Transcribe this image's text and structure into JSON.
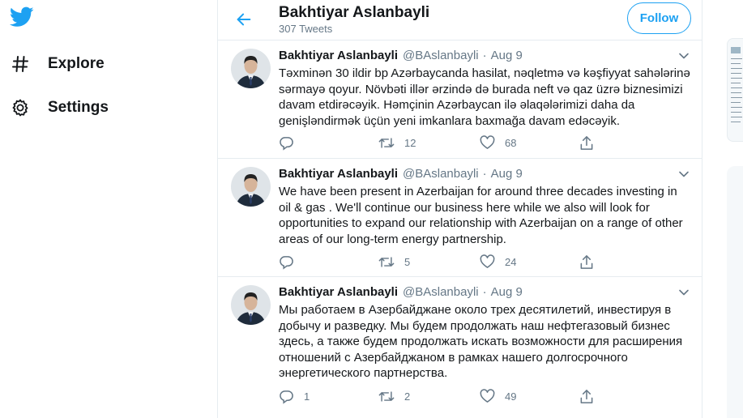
{
  "colors": {
    "accent": "#1da1f2",
    "text": "#14171a",
    "muted": "#657786",
    "border": "#e6ecf0"
  },
  "nav": {
    "logo_icon": "twitter-bird-icon",
    "items": [
      {
        "label": "Explore",
        "icon": "hashtag-icon"
      },
      {
        "label": "Settings",
        "icon": "gear-icon"
      }
    ]
  },
  "header": {
    "name": "Bakhtiyar Aslanbayli",
    "tweet_count": "307 Tweets",
    "follow_label": "Follow",
    "back_icon": "arrow-left-icon"
  },
  "tweets": [
    {
      "name": "Bakhtiyar Aslanbayli",
      "handle": "@BAslanbayli",
      "separator": "·",
      "date": "Aug 9",
      "text": "Təxminən 30 ildir bp Azərbaycanda hasilat, nəqletmə və kəşfiyyat sahələrinə\nsərmayə qoyur. Növbəti illər ərzində də  burada neft və qaz üzrə biznesimizi\ndavam etdirəcəyik. Həmçinin Azərbaycan ilə əlaqələrimizi daha da\ngenişləndirmək üçün yeni imkanlara baxmağa davam edəcəyik.",
      "replies": "",
      "retweets": "12",
      "likes": "68"
    },
    {
      "name": "Bakhtiyar Aslanbayli",
      "handle": "@BAslanbayli",
      "separator": "·",
      "date": "Aug 9",
      "text": "We have been present in Azerbaijan for around three decades investing in\noil & gas . We'll continue our business here while we also will look for\nopportunities to expand our relationship with Azerbaijan on a range of other\nareas of our long-term energy partnership.",
      "replies": "",
      "retweets": "5",
      "likes": "24"
    },
    {
      "name": "Bakhtiyar Aslanbayli",
      "handle": "@BAslanbayli",
      "separator": "·",
      "date": "Aug 9",
      "text": "Мы работаем в Азербайджане около трех десятилетий, инвестируя в\nдобычу и разведку. Мы будем продолжать наш нефтегазовый бизнес\nздесь, а также будем продолжать искать возможности для расширения\nотношений с Азербайджаном в рамках нашего долгосрочного\nэнергетического партнерства.",
      "replies": "1",
      "retweets": "2",
      "likes": "49"
    }
  ]
}
